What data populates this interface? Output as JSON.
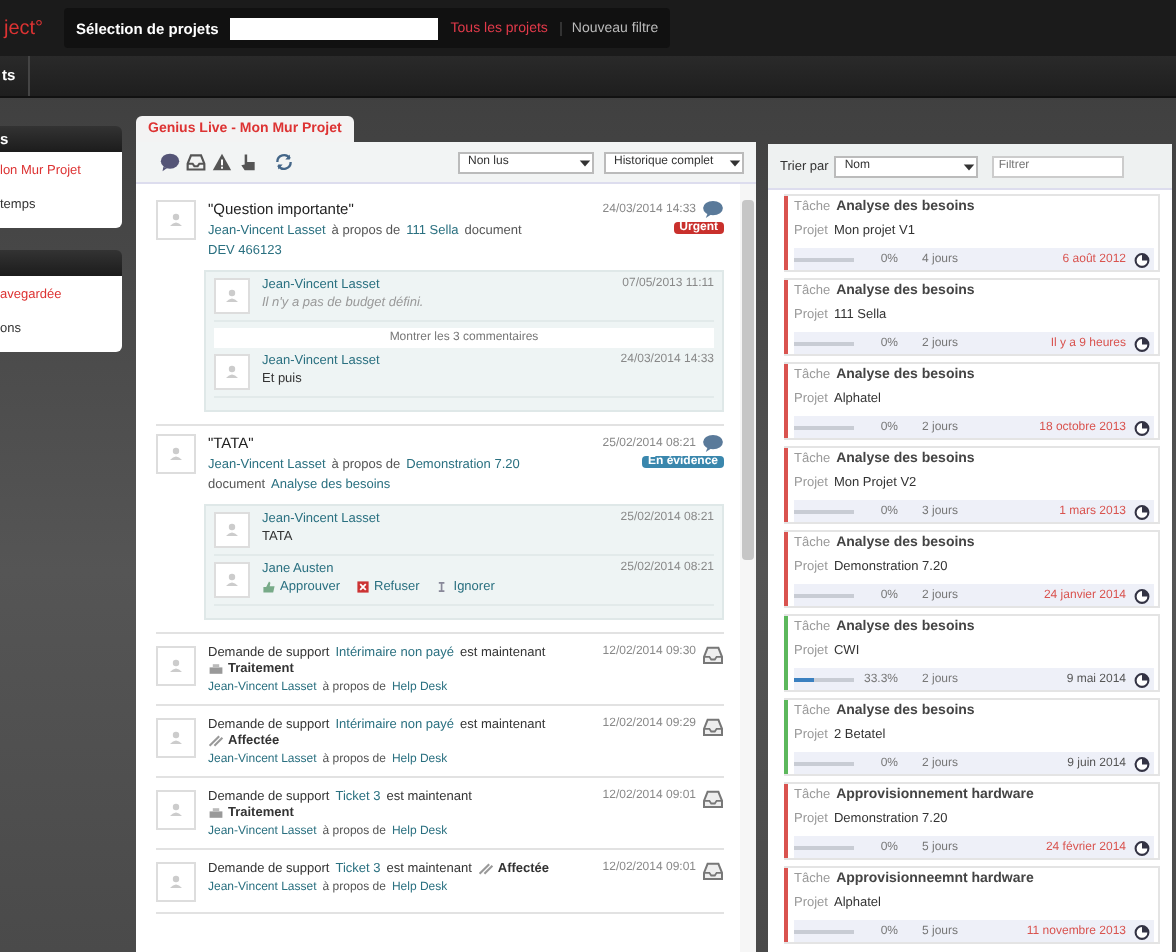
{
  "topbar": {
    "logo": "ject°",
    "project_label": "Sélection de projets",
    "all_projects": "Tous les projets",
    "new_filter": "Nouveau filtre"
  },
  "subbar": {
    "tab": "ts"
  },
  "sidebar": {
    "panels": [
      {
        "header": "s",
        "items": [
          {
            "label": "lon Mur Projet",
            "selected": true
          },
          {
            "label": "temps",
            "selected": false
          }
        ]
      },
      {
        "items": [
          {
            "label": "avegardée",
            "selected": true
          },
          {
            "label": "ons",
            "selected": false
          }
        ]
      }
    ]
  },
  "feed": {
    "tab": "Genius Live - Mon Mur Projet",
    "read_filter": "Non lus",
    "history_filter": "Historique complet",
    "posts": [
      {
        "title": "\"Question importante\"",
        "date": "24/03/2014 14:33",
        "badge": {
          "label": "Urgent",
          "color": "#c9302c"
        },
        "meta": [
          {
            "kind": "link",
            "text": "Jean-Vincent Lasset"
          },
          {
            "kind": "text",
            "text": "à propos de"
          },
          {
            "kind": "link",
            "text": "111 Sella"
          },
          {
            "kind": "text",
            "text": "document"
          },
          {
            "kind": "link",
            "text": "DEV 466123"
          }
        ],
        "comments": [
          {
            "kind": "comment",
            "author": "Jean-Vincent Lasset",
            "text": "Il n'y a pas de budget défini.",
            "italic": true,
            "date": "07/05/2013 11:11"
          },
          {
            "kind": "more",
            "text": "Montrer les 3 commentaires"
          },
          {
            "kind": "comment",
            "author": "Jean-Vincent Lasset",
            "text": "Et puis",
            "italic": false,
            "date": "24/03/2014 14:33"
          }
        ]
      },
      {
        "title": "\"TATA\"",
        "date": "25/02/2014 08:21",
        "badge": {
          "label": "En évidence",
          "color": "#3a87ad"
        },
        "meta": [
          {
            "kind": "link",
            "text": "Jean-Vincent Lasset"
          },
          {
            "kind": "text",
            "text": "à propos de"
          },
          {
            "kind": "link",
            "text": "Demonstration 7.20"
          },
          {
            "kind": "text",
            "text": "document"
          },
          {
            "kind": "link",
            "text": "Analyse des besoins"
          }
        ],
        "comments": [
          {
            "kind": "comment",
            "author": "Jean-Vincent Lasset",
            "text": "TATA",
            "italic": false,
            "date": "25/02/2014 08:21"
          },
          {
            "kind": "approval",
            "author": "Jane Austen",
            "date": "25/02/2014 08:21",
            "actions": [
              {
                "kind": "approve",
                "label": "Approuver"
              },
              {
                "kind": "refuse",
                "label": "Refuser"
              },
              {
                "kind": "ignore",
                "label": "Ignorer"
              }
            ]
          }
        ]
      }
    ],
    "events": [
      {
        "prefix": "Demande de support",
        "ticket": "Intérimaire non payé",
        "verb": "est maintenant",
        "status": {
          "kind": "processing",
          "label": "Traitement"
        },
        "date": "12/02/2014 09:30",
        "author": "Jean-Vincent Lasset",
        "about": "à propos de",
        "project": "Help Desk"
      },
      {
        "prefix": "Demande de support",
        "ticket": "Intérimaire non payé",
        "verb": "est maintenant",
        "status": {
          "kind": "assigned",
          "label": "Affectée"
        },
        "date": "12/02/2014 09:29",
        "author": "Jean-Vincent Lasset",
        "about": "à propos de",
        "project": "Help Desk"
      },
      {
        "prefix": "Demande de support",
        "ticket": "Ticket 3",
        "verb": "est maintenant",
        "status": {
          "kind": "processing",
          "label": "Traitement"
        },
        "date": "12/02/2014 09:01",
        "author": "Jean-Vincent Lasset",
        "about": "à propos de",
        "project": "Help Desk"
      },
      {
        "prefix": "Demande de support",
        "ticket": "Ticket 3",
        "verb": "est maintenant",
        "status": {
          "kind": "assigned",
          "label": "Affectée"
        },
        "date": "12/02/2014 09:01",
        "author": "Jean-Vincent Lasset",
        "about": "à propos de",
        "project": "Help Desk"
      }
    ]
  },
  "tasks": {
    "sort_label": "Trier par",
    "sort_value": "Nom",
    "filter": {
      "placeholder": "Filtrer"
    },
    "cards": [
      {
        "color": "#d9534f",
        "task_label": "Tâche",
        "task": "Analyse des besoins",
        "project_label": "Projet",
        "project": "Mon projet V1",
        "level": 0,
        "percent": "0%",
        "duration": "4 jours",
        "date": "6 août 2012",
        "overdue": true
      },
      {
        "color": "#d9534f",
        "task_label": "Tâche",
        "task": "Analyse des besoins",
        "project_label": "Projet",
        "project": "111 Sella",
        "level": 0,
        "percent": "0%",
        "duration": "2 jours",
        "date": "Il y a 9 heures",
        "overdue": true
      },
      {
        "color": "#d9534f",
        "task_label": "Tâche",
        "task": "Analyse des besoins",
        "project_label": "Projet",
        "project": "Alphatel",
        "level": 0,
        "percent": "0%",
        "duration": "2 jours",
        "date": "18 octobre 2013",
        "overdue": true
      },
      {
        "color": "#d9534f",
        "task_label": "Tâche",
        "task": "Analyse des besoins",
        "project_label": "Projet",
        "project": "Mon Projet V2",
        "level": 0,
        "percent": "0%",
        "duration": "3 jours",
        "date": "1 mars 2013",
        "overdue": true
      },
      {
        "color": "#d9534f",
        "task_label": "Tâche",
        "task": "Analyse des besoins",
        "project_label": "Projet",
        "project": "Demonstration 7.20",
        "level": 0,
        "percent": "0%",
        "duration": "2 jours",
        "date": "24 janvier 2014",
        "overdue": true
      },
      {
        "color": "#5cb85c",
        "task_label": "Tâche",
        "task": "Analyse des besoins",
        "project_label": "Projet",
        "project": "CWI",
        "level": 0.333,
        "percent": "33.3%",
        "duration": "2 jours",
        "date": "9 mai 2014",
        "overdue": false
      },
      {
        "color": "#5cb85c",
        "task_label": "Tâche",
        "task": "Analyse des besoins",
        "project_label": "Projet",
        "project": "2 Betatel",
        "level": 0,
        "percent": "0%",
        "duration": "2 jours",
        "date": "9 juin 2014",
        "overdue": false
      },
      {
        "color": "#d9534f",
        "task_label": "Tâche",
        "task": "Approvisionnement hardware",
        "project_label": "Projet",
        "project": "Demonstration 7.20",
        "level": 0,
        "percent": "0%",
        "duration": "5 jours",
        "date": "24 février 2014",
        "overdue": true
      },
      {
        "color": "#d9534f",
        "task_label": "Tâche",
        "task": "Approvisionneemnt hardware",
        "project_label": "Projet",
        "project": "Alphatel",
        "level": 0,
        "percent": "0%",
        "duration": "5 jours",
        "date": "11 novembre 2013",
        "overdue": true
      }
    ]
  }
}
